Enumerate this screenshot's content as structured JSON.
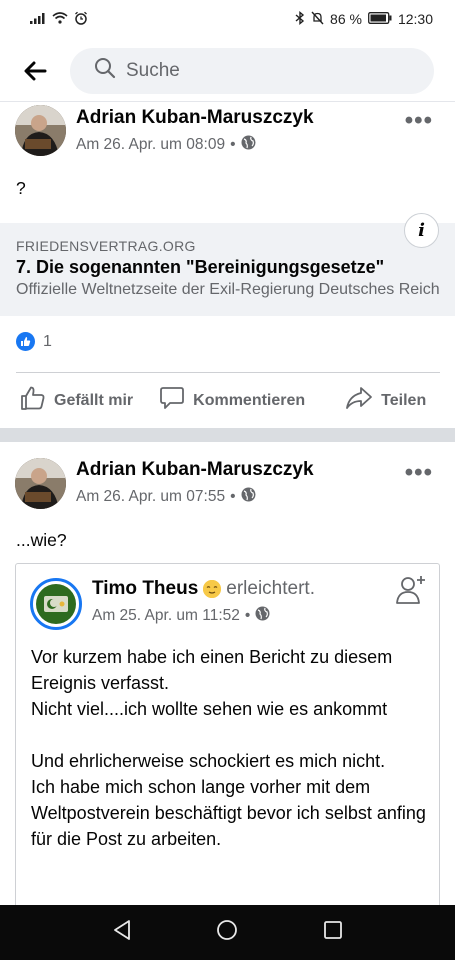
{
  "status": {
    "battery": "86 %",
    "time": "12:30"
  },
  "search": {
    "placeholder": "Suche"
  },
  "post1": {
    "author": "Adrian Kuban-Maruszczyk",
    "time": "Am 26. Apr. um 08:09",
    "separator": "•",
    "text": "?",
    "link": {
      "domain": "FRIEDENSVERTRAG.ORG",
      "title": "7. Die sogenannten \"Bereinigungsgesetze\"",
      "description": "Offizielle Weltnetzseite der Exil-Regierung Deutsches Reich"
    },
    "like_count": "1",
    "actions": {
      "like": "Gefällt mir",
      "comment": "Kommentieren",
      "share": "Teilen"
    }
  },
  "post2": {
    "author": "Adrian Kuban-Maruszczyk",
    "time": "Am 26. Apr. um 07:55",
    "separator": "•",
    "text": "...wie?",
    "shared": {
      "author": "Timo Theus",
      "feeling": "erleichtert.",
      "time": "Am 25. Apr. um 11:52",
      "separator": "•",
      "lines": [
        "Vor kurzem habe ich einen Bericht zu diesem Ereignis verfasst.",
        "Nicht viel....ich wollte sehen wie es ankommt",
        "Und ehrlicherweise schockiert es mich nicht.",
        "Ich habe mich schon lange vorher mit dem Weltpostverein beschäftigt bevor ich selbst anfing für die Post zu arbeiten."
      ]
    }
  },
  "colors": {
    "accent": "#1877f2",
    "secondary_text": "#65676b",
    "divider": "#dadde1"
  }
}
